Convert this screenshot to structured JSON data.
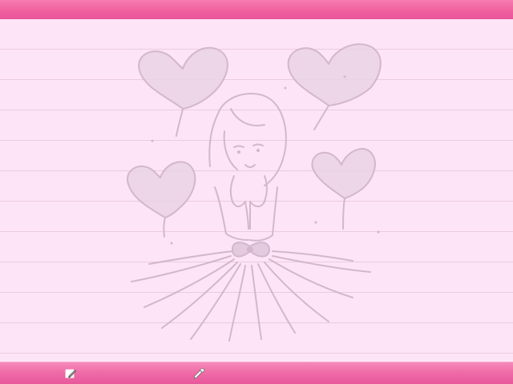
{
  "header": {},
  "canvas": {
    "background": "lined paper",
    "line_color": "#eccbe2",
    "paper_color": "#fde4f7",
    "sketch_color": "#cfb3c8",
    "drawing_subject": "sketch"
  },
  "toolbar": {
    "items": [
      {
        "icon": "pencil-icon",
        "name": "edit"
      },
      {
        "icon": "eyedropper-icon",
        "name": "color-picker"
      }
    ]
  },
  "colors": {
    "accent": "#ef6aa6",
    "top_bar": "#f0609f",
    "bottom_bar": "#ef6aa6"
  }
}
